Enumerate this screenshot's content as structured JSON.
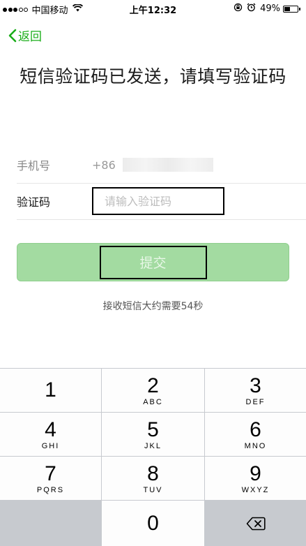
{
  "status_bar": {
    "carrier": "中国移动",
    "time": "上午12:32",
    "battery": "49%",
    "battery_level": 0.49,
    "signal_bars": 3,
    "signal_total": 5
  },
  "nav": {
    "back_label": "返回"
  },
  "title": "短信验证码已发送，请填写验证码",
  "form": {
    "phone_label": "手机号",
    "country_code": "+86",
    "code_label": "验证码",
    "code_placeholder": "请输入验证码",
    "code_value": ""
  },
  "submit_label": "提交",
  "countdown_text": "接收短信大约需要54秒",
  "keypad": {
    "keys": [
      {
        "num": "1",
        "letters": ""
      },
      {
        "num": "2",
        "letters": "ABC"
      },
      {
        "num": "3",
        "letters": "DEF"
      },
      {
        "num": "4",
        "letters": "GHI"
      },
      {
        "num": "5",
        "letters": "JKL"
      },
      {
        "num": "6",
        "letters": "MNO"
      },
      {
        "num": "7",
        "letters": "PQRS"
      },
      {
        "num": "8",
        "letters": "TUV"
      },
      {
        "num": "9",
        "letters": "WXYZ"
      },
      {
        "num": "0",
        "letters": ""
      }
    ],
    "delete_icon": "backspace-icon"
  },
  "colors": {
    "accent": "#1aad19",
    "submit_disabled": "#a3dba1",
    "keypad_bg": "#c7cacf"
  }
}
